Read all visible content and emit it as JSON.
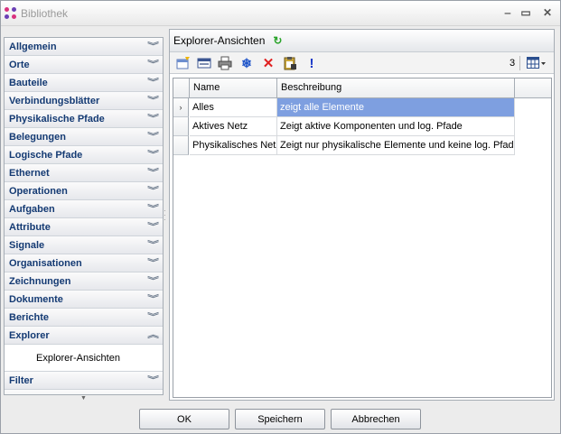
{
  "window": {
    "title": "Bibliothek"
  },
  "sidebar": {
    "items": [
      {
        "label": "Allgemein"
      },
      {
        "label": "Orte"
      },
      {
        "label": "Bauteile"
      },
      {
        "label": "Verbindungsblätter"
      },
      {
        "label": "Physikalische Pfade"
      },
      {
        "label": "Belegungen"
      },
      {
        "label": "Logische Pfade"
      },
      {
        "label": "Ethernet"
      },
      {
        "label": "Operationen"
      },
      {
        "label": "Aufgaben"
      },
      {
        "label": "Attribute"
      },
      {
        "label": "Signale"
      },
      {
        "label": "Organisationen"
      },
      {
        "label": "Zeichnungen"
      },
      {
        "label": "Dokumente"
      },
      {
        "label": "Berichte"
      },
      {
        "label": "Explorer"
      }
    ],
    "expanded_sub_item": "Explorer-Ansichten",
    "after_items": [
      {
        "label": "Filter"
      }
    ]
  },
  "panel": {
    "title": "Explorer-Ansichten",
    "toolbar": {
      "count": "3"
    },
    "grid": {
      "columns": [
        "Name",
        "Beschreibung"
      ],
      "rows": [
        {
          "name": "Alles",
          "description": "zeigt alle Elemente",
          "selected": true
        },
        {
          "name": "Aktives Netz",
          "description": "Zeigt aktive Komponenten und log. Pfade"
        },
        {
          "name": "Physikalisches Netz",
          "description": "Zeigt nur physikalische Elemente und keine log. Pfade"
        }
      ]
    }
  },
  "buttons": {
    "ok": "OK",
    "save": "Speichern",
    "cancel": "Abbrechen"
  },
  "colors": {
    "accent_selected": "#7e9fe0",
    "sidebar_text": "#143a73"
  }
}
